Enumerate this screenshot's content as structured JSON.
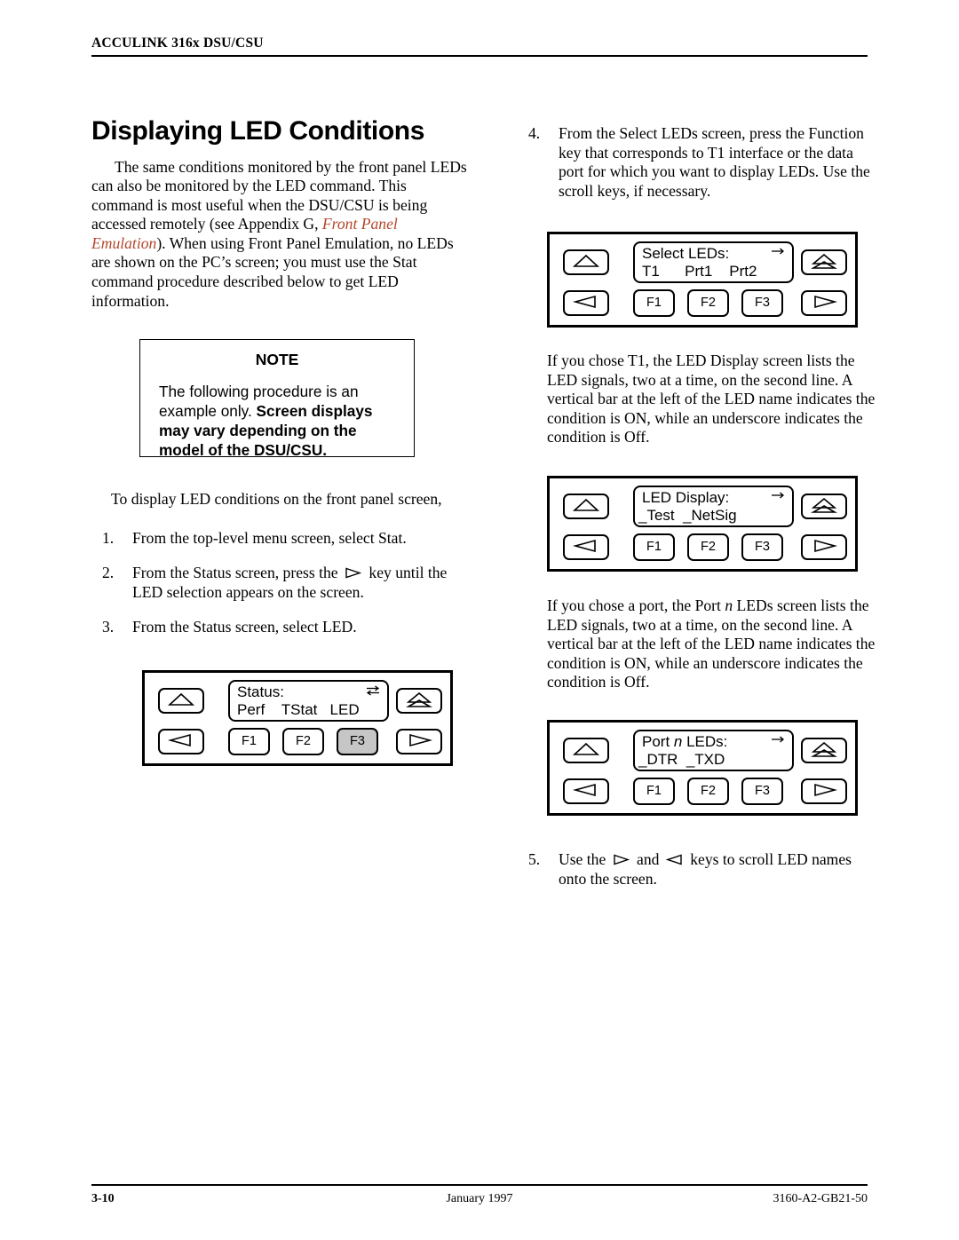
{
  "header": {
    "running_head": "ACCULINK 316x DSU/CSU"
  },
  "left_column": {
    "title": "Displaying LED Conditions",
    "intro_parts": {
      "a": "The same conditions monitored by the front panel LEDs can also be monitored by the LED command. This command is most useful when the DSU/CSU is being accessed remotely (see Appendix G, ",
      "xref": "Front Panel Emulation",
      "b": "). When using Front Panel Emulation, no LEDs are shown on the PC’s screen; you must use the Stat command procedure described below to get LED information."
    },
    "note": {
      "title": "NOTE",
      "text_a": "The following procedure is an example only. ",
      "text_bold": "Screen displays may vary depending on the model of the DSU/CSU."
    },
    "lead_in": "To display LED conditions on the front panel screen,",
    "steps": [
      {
        "num": "1.",
        "text": "From the top-level menu screen, select Stat."
      },
      {
        "num": "2.",
        "text_a": "From the Status screen, press the ",
        "key": "right-arrow-key",
        "text_b": " key until the LED selection appears on the screen."
      },
      {
        "num": "3.",
        "text": "From the Status screen, select LED."
      }
    ]
  },
  "right_column": {
    "step4": {
      "num": "4.",
      "text": "From the Select LEDs screen, press the Function key that corresponds to T1 interface or the data port for which you want to display LEDs. Use the scroll keys, if necessary."
    },
    "para_t1": "If you chose T1, the LED Display screen lists the LED signals, two at a time, on the second line. A vertical bar at the left of the LED name indicates the condition is ON, while an underscore indicates the condition is Off.",
    "para_port_a": "If you chose a port, the Port ",
    "para_port_italic": "n",
    "para_port_b": " LEDs screen lists the LED signals, two at a time, on the second line. A vertical bar at the left of the LED name indicates the condition is ON, while an underscore indicates the condition is Off.",
    "step5": {
      "num": "5.",
      "text_a": "Use the ",
      "key1": "right-arrow-key",
      "text_b": " and ",
      "key2": "left-arrow-key",
      "text_c": " keys to scroll LED names onto the screen."
    }
  },
  "panels": {
    "status": {
      "name": "status-panel",
      "lcd_line1": "Status:",
      "lcd_line2": "Perf    TStat   LED",
      "lcd_icon": "bidirectional-arrow-icon",
      "buttons": {
        "up": "scroll-up-key",
        "left": "scroll-left-key",
        "home": "home-key",
        "right": "scroll-right-key",
        "f1": "F1",
        "f2": "F2",
        "f3": "F3"
      },
      "selected_fkey": "F3"
    },
    "select_leds": {
      "name": "select-leds-panel",
      "lcd_line1": "Select LEDs:",
      "lcd_line2": "T1      Prt1    Prt2",
      "lcd_icon": "right-arrow-icon",
      "buttons": {
        "f1": "F1",
        "f2": "F2",
        "f3": "F3"
      },
      "selected_fkey": ""
    },
    "led_display": {
      "name": "led-display-panel",
      "lcd_line1": "LED Display:",
      "lcd_line2": "_Test  _NetSig",
      "lcd_icon": "right-arrow-icon",
      "buttons": {
        "f1": "F1",
        "f2": "F2",
        "f3": "F3"
      },
      "selected_fkey": ""
    },
    "port_leds": {
      "name": "port-n-leds-panel",
      "lcd_line1_a": "Port ",
      "lcd_line1_italic": "n",
      "lcd_line1_b": " LEDs:",
      "lcd_line2": "_DTR  _TXD",
      "lcd_icon": "right-arrow-icon",
      "buttons": {
        "f1": "F1",
        "f2": "F2",
        "f3": "F3"
      },
      "selected_fkey": ""
    }
  },
  "footer": {
    "page_number": "3-10",
    "date": "January 1997",
    "doc_number": "3160-A2-GB21-50"
  },
  "colors": {
    "xref": "#b3472c",
    "selected_key_fill": "#c6c6c6",
    "ink": "#000000",
    "page": "#ffffff"
  }
}
